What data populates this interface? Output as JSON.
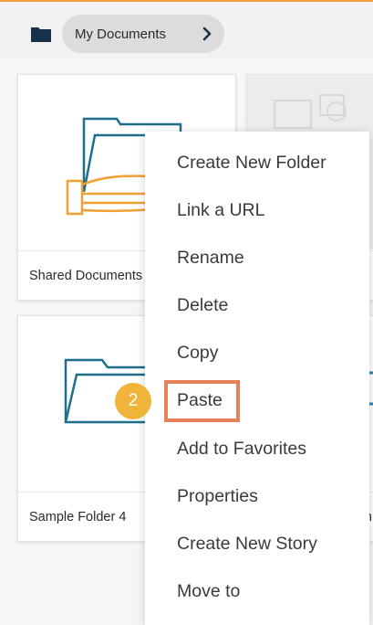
{
  "breadcrumb": {
    "label": "My Documents"
  },
  "cards": [
    {
      "name": "Shared Documents"
    },
    {
      "name": "Sample Folder 4"
    },
    {
      "name": ""
    },
    {
      "name": "h"
    }
  ],
  "context_menu": {
    "items": [
      "Create New Folder",
      "Link a URL",
      "Rename",
      "Delete",
      "Copy",
      "Paste",
      "Add to Favorites",
      "Properties",
      "Create New Story",
      "Move to"
    ]
  },
  "step_badge": {
    "number": "2"
  },
  "colors": {
    "accent_orange": "#e9a23b",
    "folder_teal": "#1f6f8b",
    "highlight_box": "#e8805a",
    "badge": "#f0b43a"
  }
}
